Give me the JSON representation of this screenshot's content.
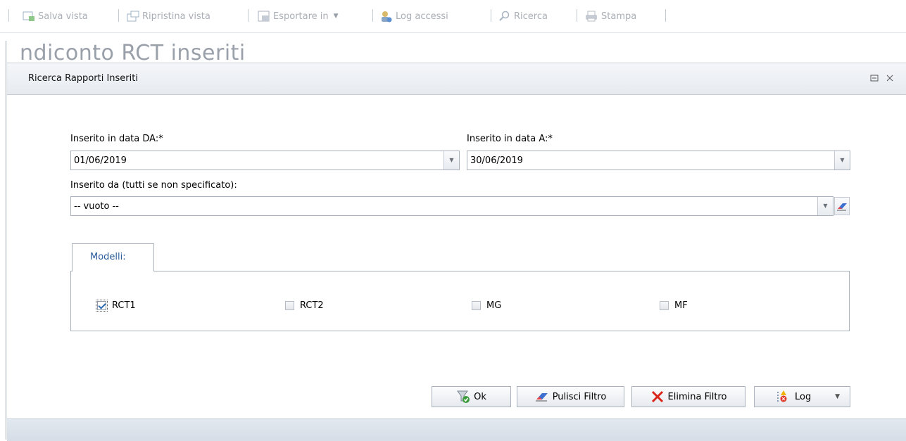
{
  "toolbar": {
    "items": [
      {
        "label": "Salva vista",
        "icon": "save-view-icon"
      },
      {
        "label": "Ripristina vista",
        "icon": "restore-view-icon"
      },
      {
        "label": "Esportare in",
        "icon": "export-icon",
        "dropdown": true
      },
      {
        "label": "Log accessi",
        "icon": "access-log-icon"
      },
      {
        "label": "Ricerca",
        "icon": "search-icon"
      },
      {
        "label": "Stampa",
        "icon": "print-icon"
      }
    ]
  },
  "background_title": "ndiconto RCT inseriti",
  "dialog": {
    "title": "Ricerca Rapporti Inseriti",
    "date_from": {
      "label": "Inserito in data DA:*",
      "value": "01/06/2019"
    },
    "date_to": {
      "label": "Inserito in data A:*",
      "value": "30/06/2019"
    },
    "inserted_by": {
      "label": "Inserito da (tutti se non specificato):",
      "value": "-- vuoto --"
    },
    "tab_label": "Modelli:",
    "models": [
      {
        "label": "RCT1",
        "checked": true
      },
      {
        "label": "RCT2",
        "checked": false
      },
      {
        "label": "MG",
        "checked": false
      },
      {
        "label": "MF",
        "checked": false
      }
    ],
    "buttons": {
      "ok": "Ok",
      "clear_filter": "Pulisci Filtro",
      "delete_filter": "Elimina Filtro",
      "log": "Log"
    }
  },
  "colors": {
    "accent": "#2b5c9a",
    "border": "#a8b1bc",
    "delete": "#d9261c"
  }
}
